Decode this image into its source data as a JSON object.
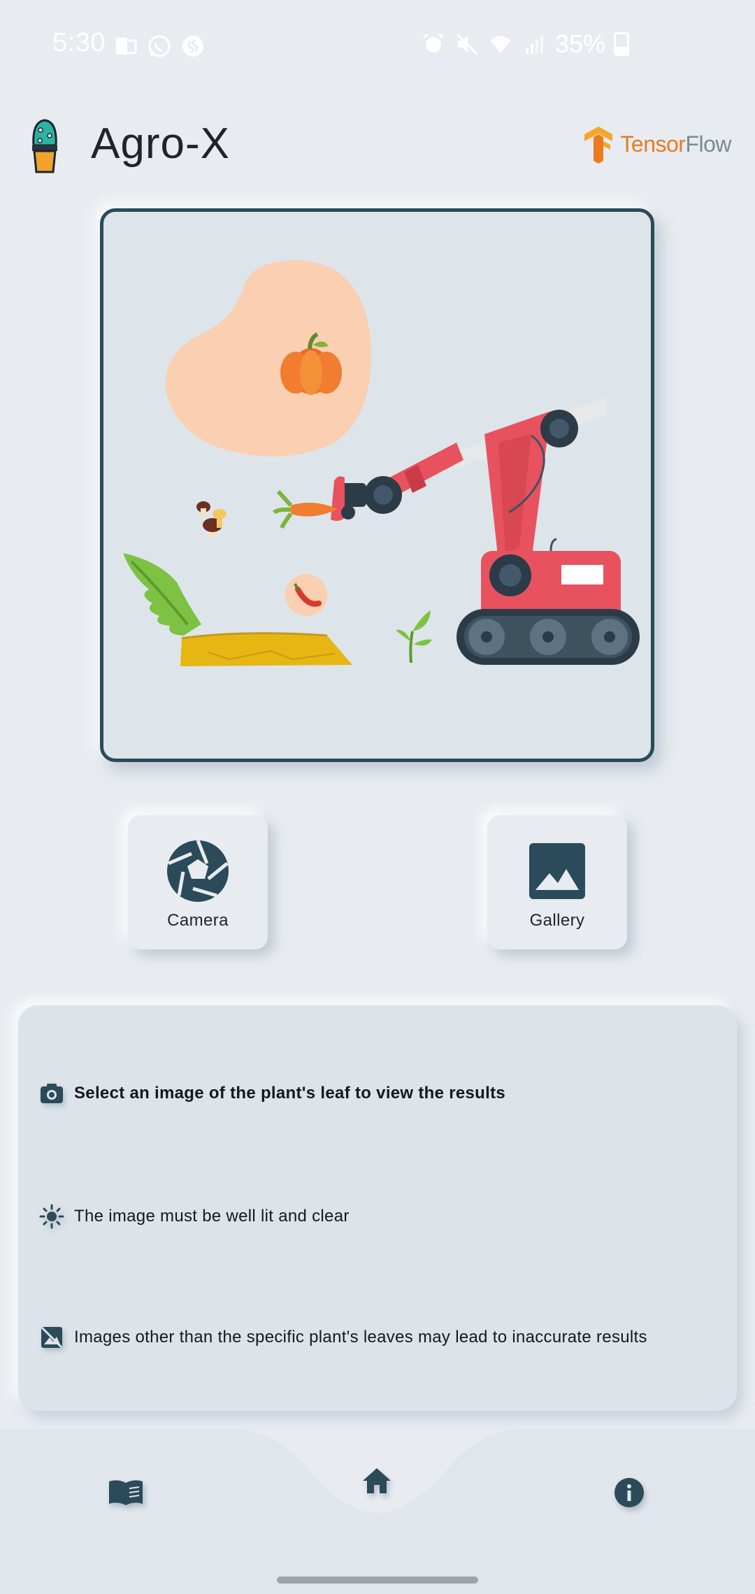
{
  "status_bar": {
    "time": "5:30",
    "battery": "35%",
    "left_icons": [
      "notification-icon",
      "whatsapp-icon",
      "shazam-icon"
    ],
    "right_icons": [
      "alarm-icon",
      "mute-icon",
      "wifi-icon",
      "signal-icon",
      "battery-icon"
    ]
  },
  "header": {
    "app_title": "Agro-X",
    "partner_logo_text_1": "Tensor",
    "partner_logo_text_2": "Flow"
  },
  "illustration": {
    "description_icon": "farm-robot-harvest-illustration"
  },
  "actions": {
    "camera_label": "Camera",
    "gallery_label": "Gallery"
  },
  "info": {
    "items": [
      {
        "icon": "camera-icon",
        "text": "Select an image of the plant's leaf to view the results"
      },
      {
        "icon": "brightness-icon",
        "text": "The image must be well lit and clear"
      },
      {
        "icon": "no-image-icon",
        "text": "Images other than the specific plant's leaves may lead to inaccurate results"
      }
    ]
  },
  "bottom_nav": {
    "items": [
      {
        "icon": "book-icon",
        "active": false
      },
      {
        "icon": "home-icon",
        "active": true
      },
      {
        "icon": "info-icon",
        "active": false
      }
    ]
  },
  "colors": {
    "background": "#e8ecf1",
    "accent": "#2b4a5a",
    "panel": "#dce4e9",
    "robot_red": "#e8525f",
    "blob": "#fbcfb1"
  }
}
